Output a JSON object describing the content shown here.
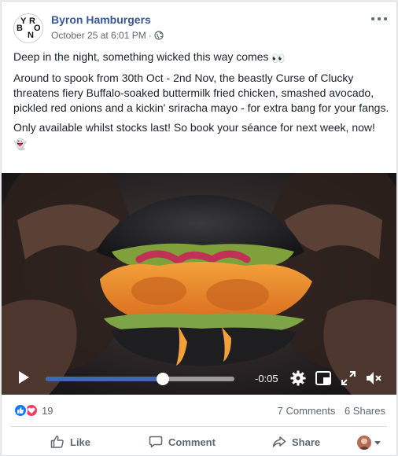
{
  "post": {
    "page_name": "Byron Hamburgers",
    "timestamp": "October 25 at 6:01 PM",
    "separator": "·",
    "logo_letters": [
      "Y",
      "R",
      "B",
      "O",
      "N"
    ],
    "paragraphs": {
      "p1": "Deep in the night, something wicked this way comes",
      "p1_emoji": "👀",
      "p2": "Around to spook from 30th Oct - 2nd Nov, the beastly Curse of Clucky threatens fiery Buffalo-soaked buttermilk fried chicken, smashed avocado, pickled red onions and a kickin' sriracha mayo - for extra bang for your fangs.",
      "p3": "Only available whilst stocks last! So book your séance for next week, now!",
      "p3_emoji": "👻"
    }
  },
  "video": {
    "time_remaining": "-0:05",
    "progress": 0.62
  },
  "stats": {
    "reaction_count": "19",
    "comments": "7 Comments",
    "shares": "6 Shares"
  },
  "actions": {
    "like": "Like",
    "comment": "Comment",
    "share": "Share"
  },
  "colors": {
    "link": "#365899",
    "like_blue": "#1877f2",
    "love_red": "#f33e58",
    "progress_fill": "#4267b2"
  }
}
